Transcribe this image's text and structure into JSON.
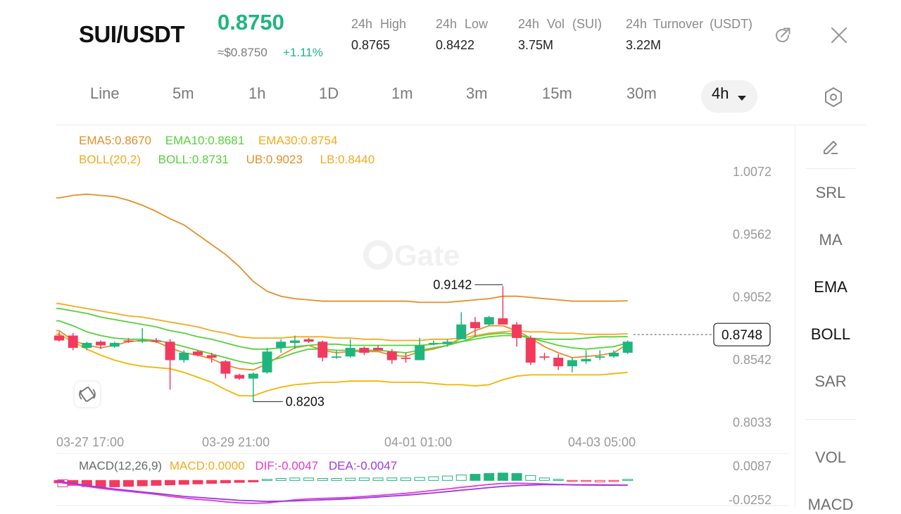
{
  "header": {
    "symbol": "SUI/USDT",
    "last_price": "0.8750",
    "approx_price": "≈$0.8750",
    "change_pct": "+1.11%",
    "stats": [
      {
        "label": "24h High",
        "value": "0.8765"
      },
      {
        "label": "24h Low",
        "value": "0.8422"
      },
      {
        "label": "24h Vol (SUI)",
        "value": "3.75M"
      },
      {
        "label": "24h Turnover (USDT)",
        "value": "3.22M"
      }
    ],
    "icons": [
      "share-icon",
      "close-icon"
    ]
  },
  "timeframes": {
    "items": [
      "Line",
      "5m",
      "1h",
      "1D",
      "1m",
      "3m",
      "15m",
      "30m",
      "4h"
    ],
    "selected": "4h",
    "settings_icon": "hexagon-gear-icon"
  },
  "indicators": {
    "ema5": "EMA5:0.8670",
    "ema10": "EMA10:0.8681",
    "ema30": "EMA30:0.8754",
    "boll": "BOLL(20,2)",
    "boll_mid": "BOLL:0.8731",
    "ub": "UB:0.9023",
    "lb": "LB:0.8440",
    "macd_label": "MACD(12,26,9)",
    "macd_val": "MACD:0.0000",
    "dif": "DIF:-0.0047",
    "dea": "DEA:-0.0047"
  },
  "chart": {
    "y_ticks": [
      "1.0072",
      "0.9562",
      "0.9052",
      "0.8542",
      "0.8033"
    ],
    "x_ticks": [
      "03-27 17:00",
      "03-29 21:00",
      "04-01 01:00",
      "04-03 05:00"
    ],
    "current_price": "0.8748",
    "high_marker": "0.9142",
    "low_marker": "0.8203",
    "macd_ticks": [
      "0.0087",
      "-0.0252"
    ],
    "watermark": "Gate"
  },
  "sidebar": {
    "items": [
      "SRL",
      "MA",
      "EMA",
      "BOLL",
      "SAR",
      "VOL",
      "MACD"
    ],
    "active": [
      "EMA",
      "BOLL"
    ],
    "draw_icon": "pencil-icon"
  },
  "colors": {
    "up": "#1fb57e",
    "down": "#f23a5f",
    "ema5": "#e2902c",
    "ema10": "#58d03c",
    "ema30": "#f3aa1e",
    "boll_band": "#f5b400",
    "boll_mid": "#58d03c"
  },
  "chart_data": {
    "type": "candlestick",
    "interval": "4h",
    "y_range": [
      0.8033,
      1.0072
    ],
    "candles": [
      {
        "o": 0.874,
        "h": 0.877,
        "l": 0.869,
        "c": 0.87
      },
      {
        "o": 0.874,
        "h": 0.876,
        "l": 0.862,
        "c": 0.864
      },
      {
        "o": 0.864,
        "h": 0.869,
        "l": 0.862,
        "c": 0.868
      },
      {
        "o": 0.869,
        "h": 0.87,
        "l": 0.863,
        "c": 0.866
      },
      {
        "o": 0.865,
        "h": 0.869,
        "l": 0.864,
        "c": 0.868
      },
      {
        "o": 0.87,
        "h": 0.872,
        "l": 0.868,
        "c": 0.869
      },
      {
        "o": 0.87,
        "h": 0.88,
        "l": 0.868,
        "c": 0.87
      },
      {
        "o": 0.87,
        "h": 0.872,
        "l": 0.868,
        "c": 0.869
      },
      {
        "o": 0.869,
        "h": 0.871,
        "l": 0.83,
        "c": 0.854
      },
      {
        "o": 0.854,
        "h": 0.862,
        "l": 0.852,
        "c": 0.86
      },
      {
        "o": 0.861,
        "h": 0.862,
        "l": 0.857,
        "c": 0.858
      },
      {
        "o": 0.858,
        "h": 0.86,
        "l": 0.852,
        "c": 0.856
      },
      {
        "o": 0.853,
        "h": 0.854,
        "l": 0.839,
        "c": 0.843
      },
      {
        "o": 0.842,
        "h": 0.843,
        "l": 0.838,
        "c": 0.839
      },
      {
        "o": 0.839,
        "h": 0.844,
        "l": 0.8203,
        "c": 0.843
      },
      {
        "o": 0.844,
        "h": 0.864,
        "l": 0.843,
        "c": 0.861
      },
      {
        "o": 0.864,
        "h": 0.871,
        "l": 0.86,
        "c": 0.869
      },
      {
        "o": 0.868,
        "h": 0.874,
        "l": 0.863,
        "c": 0.87
      },
      {
        "o": 0.871,
        "h": 0.872,
        "l": 0.868,
        "c": 0.869
      },
      {
        "o": 0.869,
        "h": 0.87,
        "l": 0.853,
        "c": 0.856
      },
      {
        "o": 0.856,
        "h": 0.862,
        "l": 0.855,
        "c": 0.857
      },
      {
        "o": 0.857,
        "h": 0.871,
        "l": 0.856,
        "c": 0.864
      },
      {
        "o": 0.864,
        "h": 0.865,
        "l": 0.858,
        "c": 0.86
      },
      {
        "o": 0.864,
        "h": 0.866,
        "l": 0.862,
        "c": 0.862
      },
      {
        "o": 0.861,
        "h": 0.863,
        "l": 0.851,
        "c": 0.854
      },
      {
        "o": 0.856,
        "h": 0.86,
        "l": 0.852,
        "c": 0.855
      },
      {
        "o": 0.854,
        "h": 0.872,
        "l": 0.854,
        "c": 0.866
      },
      {
        "o": 0.867,
        "h": 0.87,
        "l": 0.866,
        "c": 0.868
      },
      {
        "o": 0.867,
        "h": 0.871,
        "l": 0.865,
        "c": 0.869
      },
      {
        "o": 0.871,
        "h": 0.893,
        "l": 0.871,
        "c": 0.883
      },
      {
        "o": 0.885,
        "h": 0.889,
        "l": 0.873,
        "c": 0.88
      },
      {
        "o": 0.883,
        "h": 0.89,
        "l": 0.882,
        "c": 0.889
      },
      {
        "o": 0.888,
        "h": 0.9142,
        "l": 0.884,
        "c": 0.883
      },
      {
        "o": 0.883,
        "h": 0.885,
        "l": 0.865,
        "c": 0.872
      },
      {
        "o": 0.872,
        "h": 0.874,
        "l": 0.85,
        "c": 0.852
      },
      {
        "o": 0.857,
        "h": 0.86,
        "l": 0.854,
        "c": 0.856
      },
      {
        "o": 0.856,
        "h": 0.859,
        "l": 0.846,
        "c": 0.849
      },
      {
        "o": 0.849,
        "h": 0.856,
        "l": 0.844,
        "c": 0.854
      },
      {
        "o": 0.853,
        "h": 0.862,
        "l": 0.851,
        "c": 0.855
      },
      {
        "o": 0.856,
        "h": 0.862,
        "l": 0.854,
        "c": 0.857
      },
      {
        "o": 0.857,
        "h": 0.862,
        "l": 0.856,
        "c": 0.86
      },
      {
        "o": 0.86,
        "h": 0.87,
        "l": 0.859,
        "c": 0.869
      }
    ],
    "series": [
      {
        "name": "EMA5",
        "values": [
          0.878,
          0.87,
          0.866,
          0.864,
          0.866,
          0.869,
          0.87,
          0.869,
          0.864,
          0.86,
          0.858,
          0.855,
          0.85,
          0.847,
          0.846,
          0.851,
          0.858,
          0.864,
          0.866,
          0.862,
          0.86,
          0.861,
          0.861,
          0.861,
          0.858,
          0.857,
          0.861,
          0.863,
          0.866,
          0.872,
          0.878,
          0.882,
          0.882,
          0.878,
          0.872,
          0.865,
          0.86,
          0.856,
          0.857,
          0.858,
          0.86,
          0.867
        ]
      },
      {
        "name": "EMA10",
        "values": [
          0.886,
          0.882,
          0.877,
          0.874,
          0.872,
          0.871,
          0.871,
          0.87,
          0.868,
          0.865,
          0.862,
          0.859,
          0.856,
          0.853,
          0.851,
          0.853,
          0.856,
          0.86,
          0.863,
          0.863,
          0.862,
          0.862,
          0.862,
          0.862,
          0.861,
          0.86,
          0.862,
          0.864,
          0.866,
          0.869,
          0.873,
          0.875,
          0.876,
          0.875,
          0.872,
          0.869,
          0.866,
          0.864,
          0.863,
          0.864,
          0.865,
          0.868
        ]
      },
      {
        "name": "EMA30",
        "values": [
          0.9,
          0.898,
          0.896,
          0.894,
          0.892,
          0.89,
          0.889,
          0.887,
          0.885,
          0.883,
          0.881,
          0.878,
          0.876,
          0.873,
          0.872,
          0.872,
          0.872,
          0.873,
          0.873,
          0.873,
          0.872,
          0.872,
          0.871,
          0.871,
          0.87,
          0.87,
          0.87,
          0.871,
          0.871,
          0.872,
          0.874,
          0.876,
          0.877,
          0.878,
          0.877,
          0.877,
          0.876,
          0.876,
          0.875,
          0.875,
          0.875,
          0.8754
        ]
      },
      {
        "name": "BOLL",
        "values": [
          0.896,
          0.894,
          0.892,
          0.889,
          0.887,
          0.885,
          0.883,
          0.881,
          0.878,
          0.876,
          0.873,
          0.871,
          0.868,
          0.865,
          0.863,
          0.863,
          0.864,
          0.865,
          0.866,
          0.867,
          0.867,
          0.866,
          0.866,
          0.866,
          0.866,
          0.866,
          0.866,
          0.867,
          0.868,
          0.869,
          0.871,
          0.873,
          0.874,
          0.874,
          0.872,
          0.871,
          0.871,
          0.871,
          0.872,
          0.873,
          0.873,
          0.8731
        ]
      },
      {
        "name": "UB",
        "values": [
          0.986,
          0.988,
          0.989,
          0.988,
          0.987,
          0.984,
          0.98,
          0.975,
          0.969,
          0.964,
          0.956,
          0.948,
          0.94,
          0.93,
          0.918,
          0.91,
          0.906,
          0.904,
          0.903,
          0.902,
          0.902,
          0.902,
          0.902,
          0.902,
          0.902,
          0.902,
          0.901,
          0.901,
          0.901,
          0.902,
          0.903,
          0.904,
          0.906,
          0.906,
          0.905,
          0.904,
          0.903,
          0.902,
          0.902,
          0.902,
          0.902,
          0.9023
        ]
      },
      {
        "name": "LB",
        "values": [
          0.875,
          0.869,
          0.863,
          0.858,
          0.854,
          0.851,
          0.849,
          0.848,
          0.847,
          0.844,
          0.84,
          0.836,
          0.83,
          0.825,
          0.825,
          0.829,
          0.832,
          0.834,
          0.835,
          0.836,
          0.836,
          0.837,
          0.837,
          0.837,
          0.836,
          0.836,
          0.836,
          0.835,
          0.834,
          0.834,
          0.833,
          0.834,
          0.838,
          0.841,
          0.842,
          0.842,
          0.842,
          0.842,
          0.842,
          0.842,
          0.843,
          0.844
        ]
      }
    ],
    "macd": {
      "y_range": [
        -0.0252,
        0.0087
      ],
      "hist": [
        -0.001,
        -0.002,
        -0.0025,
        -0.0028,
        -0.0026,
        -0.0024,
        -0.0022,
        -0.002,
        -0.0018,
        -0.0016,
        -0.0014,
        -0.0012,
        -0.001,
        -0.0008,
        -0.0006,
        0.0004,
        0.0008,
        0.001,
        0.001,
        0.0008,
        0.0008,
        0.0009,
        0.001,
        0.001,
        0.001,
        0.001,
        0.0012,
        0.0015,
        0.0018,
        0.0022,
        0.0025,
        0.0028,
        0.003,
        0.0028,
        0.002,
        0.001,
        0.0004,
        -0.0002,
        -0.0004,
        -0.0006,
        -0.0004,
        0.0
      ],
      "dif": [
        -0.002,
        -0.004,
        -0.006,
        -0.008,
        -0.0095,
        -0.011,
        -0.0125,
        -0.014,
        -0.016,
        -0.0175,
        -0.019,
        -0.02,
        -0.0215,
        -0.0225,
        -0.023,
        -0.0225,
        -0.021,
        -0.0195,
        -0.0185,
        -0.018,
        -0.0175,
        -0.017,
        -0.016,
        -0.015,
        -0.014,
        -0.013,
        -0.0115,
        -0.01,
        -0.0085,
        -0.007,
        -0.0055,
        -0.004,
        -0.003,
        -0.0028,
        -0.003,
        -0.0035,
        -0.004,
        -0.0045,
        -0.0047,
        -0.0048,
        -0.0048,
        -0.0047
      ],
      "dea": [
        -0.001,
        -0.003,
        -0.005,
        -0.007,
        -0.0085,
        -0.01,
        -0.0115,
        -0.013,
        -0.0145,
        -0.016,
        -0.017,
        -0.018,
        -0.019,
        -0.02,
        -0.0205,
        -0.021,
        -0.0208,
        -0.0205,
        -0.02,
        -0.0195,
        -0.019,
        -0.0183,
        -0.0175,
        -0.0166,
        -0.0157,
        -0.0148,
        -0.0137,
        -0.0125,
        -0.0112,
        -0.0098,
        -0.0085,
        -0.0072,
        -0.006,
        -0.0052,
        -0.0046,
        -0.0043,
        -0.0042,
        -0.0043,
        -0.0044,
        -0.0045,
        -0.0046,
        -0.0047
      ]
    }
  }
}
